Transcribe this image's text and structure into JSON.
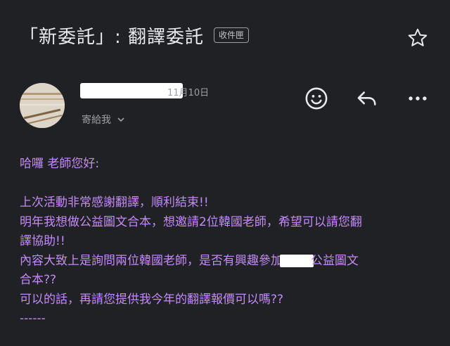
{
  "header": {
    "subject": "「新委託」: 翻譯委託",
    "folder_badge": "收件匣",
    "star_icon": "star-outline-icon"
  },
  "message": {
    "sender_name": "",
    "date": "11月10日",
    "recipient_label": "寄給我",
    "actions": [
      "emoji-reaction-icon",
      "reply-icon",
      "more-options-icon"
    ],
    "body": {
      "greeting": "哈囉 老師您好:",
      "line1": "上次活動非常感謝翻譯，順利結束!!",
      "line2": "明年我想做公益圖文合本，想邀請2位韓國老師，希望可以請您翻",
      "line3": "譯協助!!",
      "line4a": "內容大致上是詢問兩位韓國老師，是否有興趣參加",
      "line4b": "公益圖文",
      "line5": "合本??",
      "line6": "可以的話，再請您提供我今年的翻譯報價可以嗎??",
      "line7": "------"
    }
  },
  "colors": {
    "background": "#202124",
    "body_text": "#c58af9",
    "muted": "#9aa0a6"
  }
}
